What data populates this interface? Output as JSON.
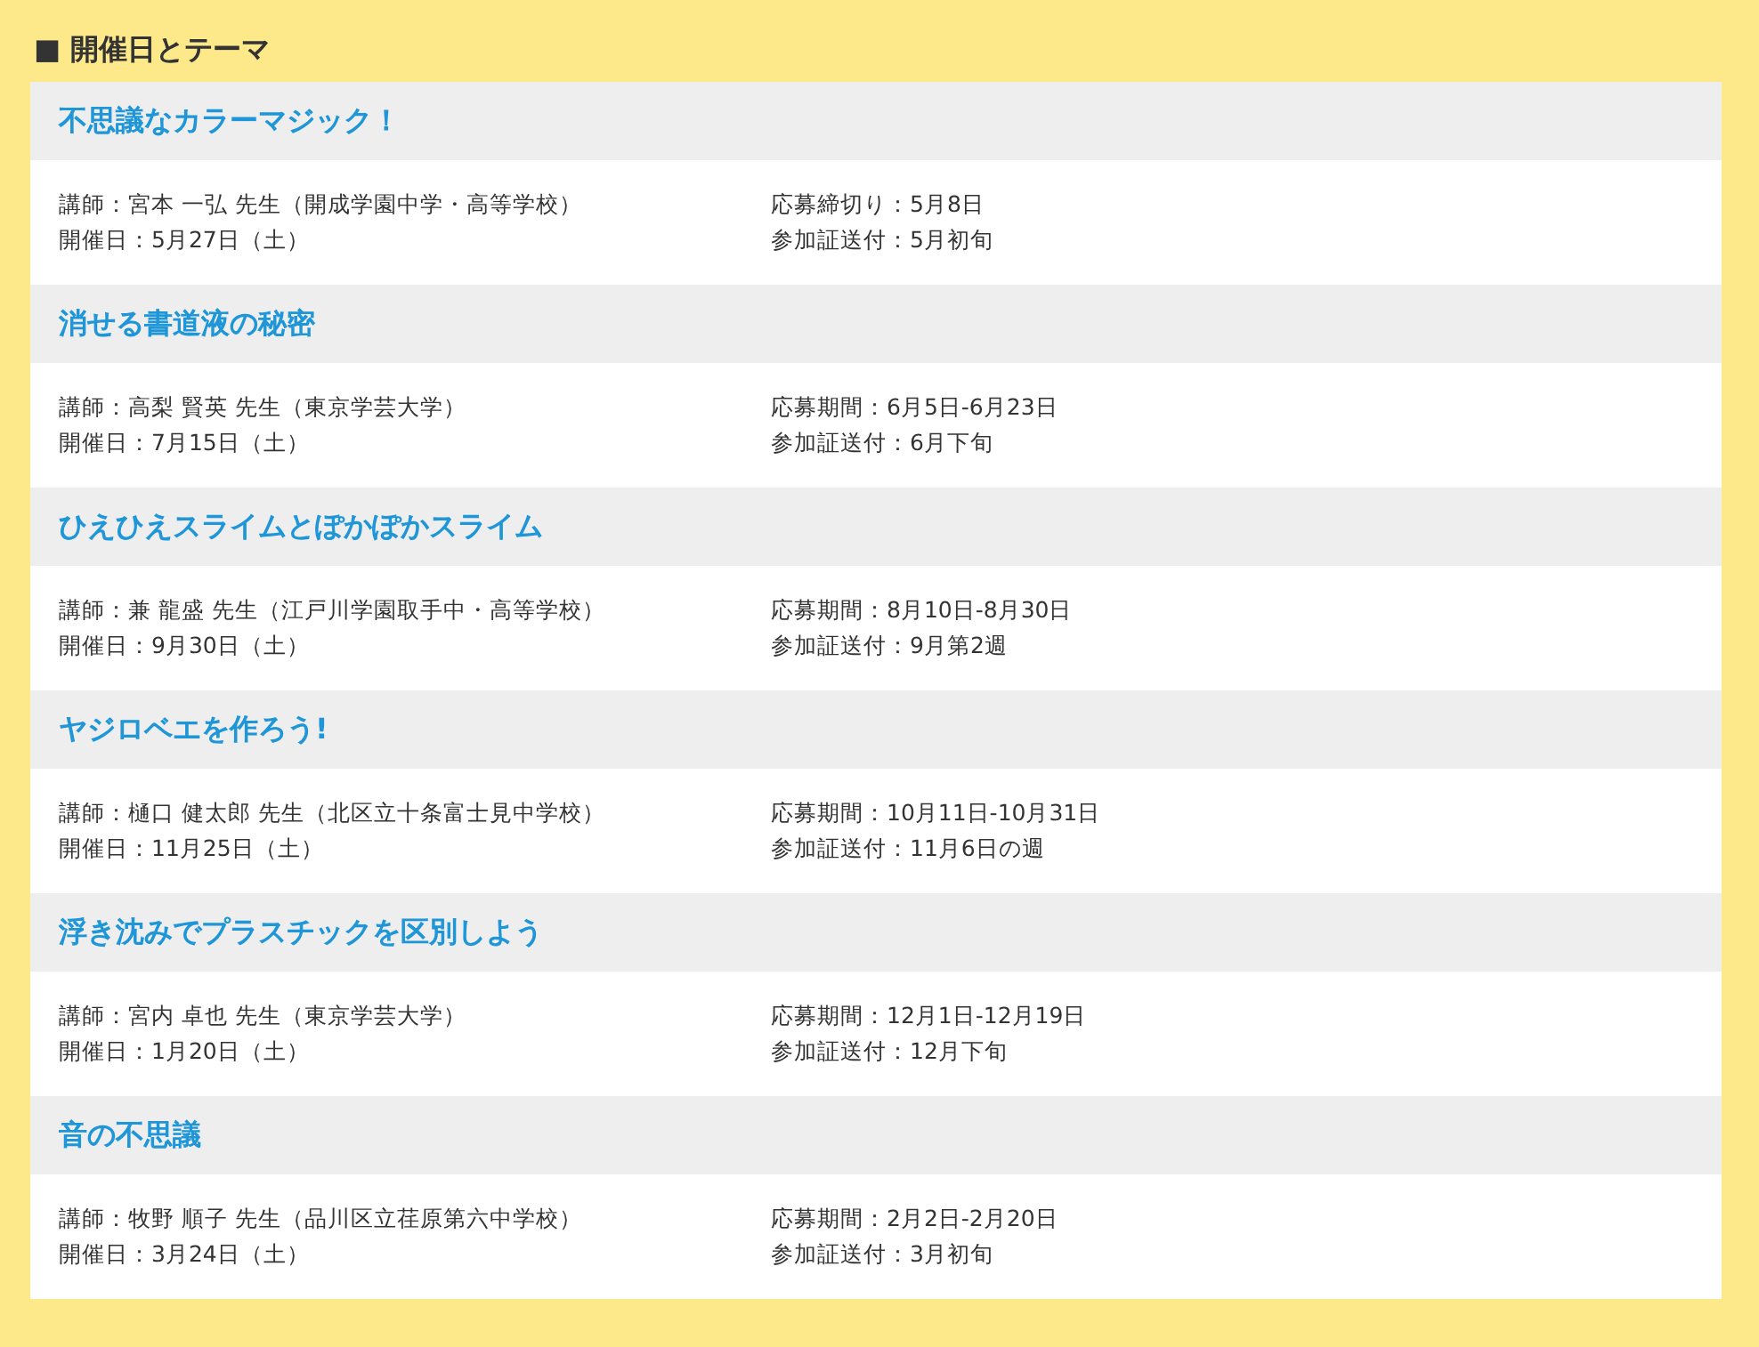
{
  "heading": "■ 開催日とテーマ",
  "events": [
    {
      "title": "不思議なカラーマジック！",
      "instructor": "講師：宮本 一弘 先生（開成学園中学・高等学校）",
      "date": "開催日：5月27日（土）",
      "application": "応募締切り：5月8日",
      "pass": "参加証送付：5月初旬"
    },
    {
      "title": "消せる書道液の秘密",
      "instructor": "講師：高梨 賢英 先生（東京学芸大学）",
      "date": "開催日：7月15日（土）",
      "application": "応募期間：6月5日-6月23日",
      "pass": "参加証送付：6月下旬"
    },
    {
      "title": "ひえひえスライムとぽかぽかスライム",
      "instructor": "講師：兼 龍盛 先生（江戸川学園取手中・高等学校）",
      "date": "開催日：9月30日（土）",
      "application": "応募期間：8月10日-8月30日",
      "pass": "参加証送付：9月第2週"
    },
    {
      "title": "ヤジロベエを作ろう!",
      "instructor": "講師：樋口 健太郎 先生（北区立十条富士見中学校）",
      "date": "開催日：11月25日（土）",
      "application": "応募期間：10月11日-10月31日",
      "pass": "参加証送付：11月6日の週"
    },
    {
      "title": "浮き沈みでプラスチックを区別しよう",
      "instructor": "講師：宮内 卓也 先生（東京学芸大学）",
      "date": "開催日：1月20日（土）",
      "application": "応募期間：12月1日-12月19日",
      "pass": "参加証送付：12月下旬"
    },
    {
      "title": "音の不思議",
      "instructor": "講師：牧野 順子 先生（品川区立荏原第六中学校）",
      "date": "開催日：3月24日（土）",
      "application": "応募期間：2月2日-2月20日",
      "pass": "参加証送付：3月初旬"
    }
  ]
}
